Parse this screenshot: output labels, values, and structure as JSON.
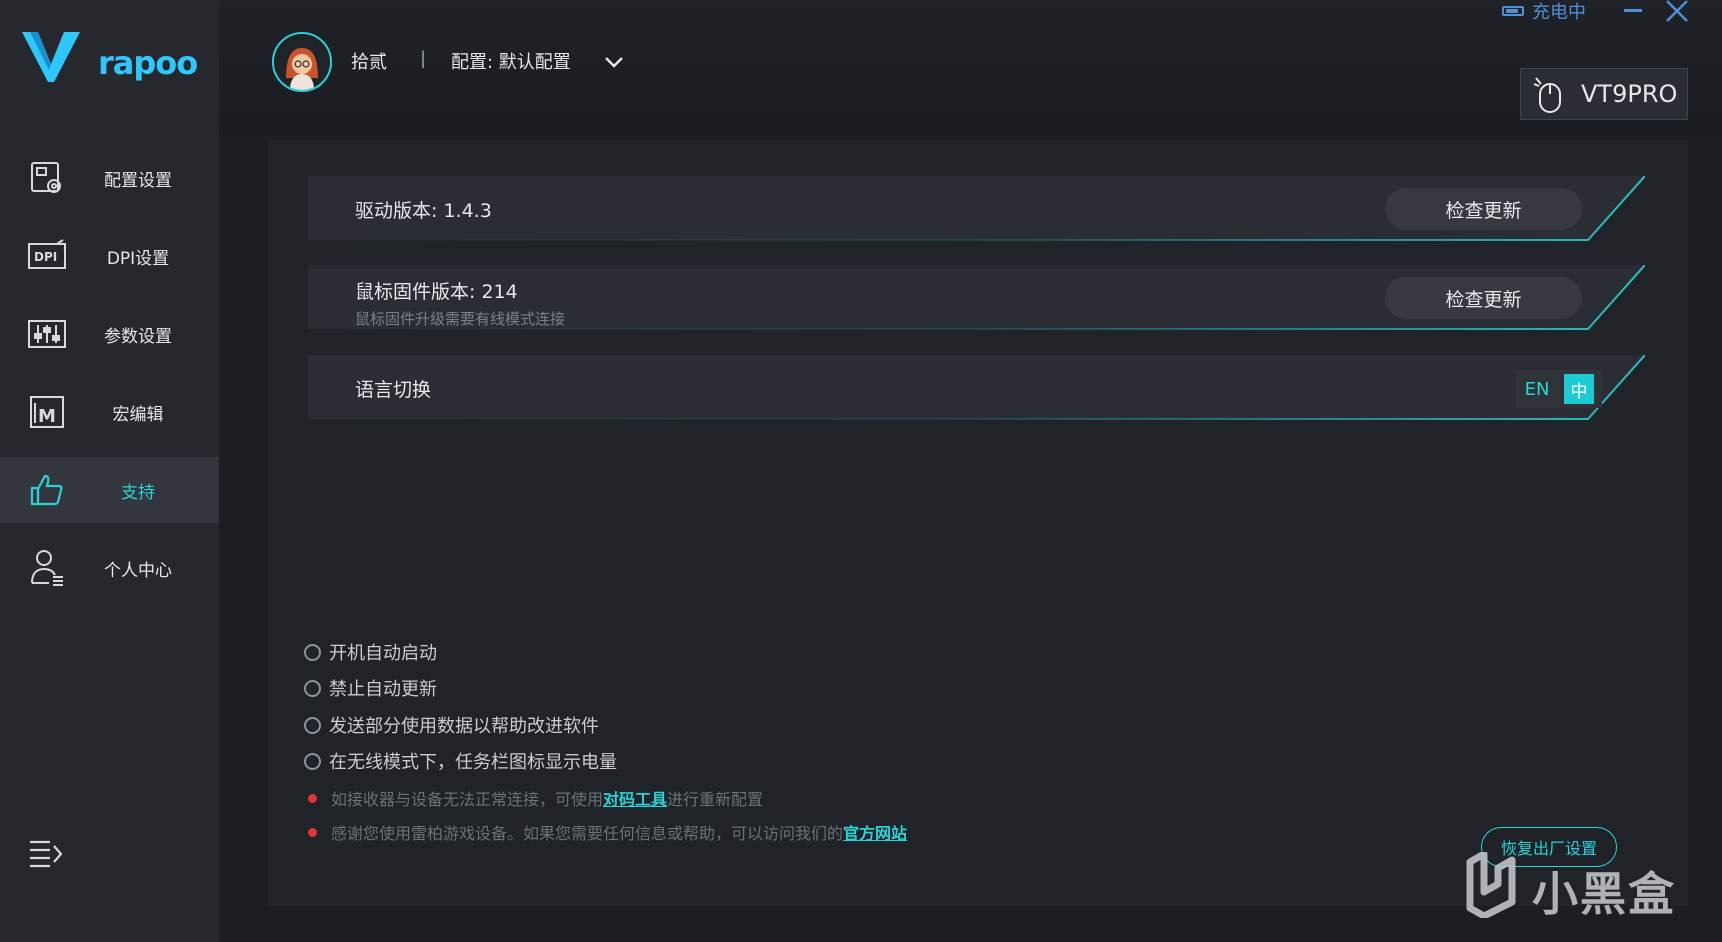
{
  "app": {
    "brand": "rapoo",
    "status": {
      "charging_text": "充电中"
    },
    "device_name": "VT9PRO"
  },
  "sidebar": {
    "items": [
      {
        "label": "配置设置",
        "icon": "profile-config-icon"
      },
      {
        "label": "DPI设置",
        "icon": "dpi-icon"
      },
      {
        "label": "参数设置",
        "icon": "sliders-icon"
      },
      {
        "label": "宏编辑",
        "icon": "macro-icon"
      },
      {
        "label": "支持",
        "icon": "thumbs-up-icon",
        "active": true
      },
      {
        "label": "个人中心",
        "icon": "user-icon"
      }
    ]
  },
  "header": {
    "username": "拾贰",
    "separator": "|",
    "profile_label": "配置: 默认配置"
  },
  "support": {
    "driver": {
      "title": "驱动版本: 1.4.3",
      "button": "检查更新"
    },
    "firmware": {
      "title": "鼠标固件版本:  214",
      "subtitle": "鼠标固件升级需要有线模式连接",
      "button": "检查更新"
    },
    "language": {
      "title": "语言切换",
      "en": "EN",
      "zh": "中",
      "selected": "zh"
    },
    "options": [
      "开机自动启动",
      "禁止自动更新",
      "发送部分使用数据以帮助改进软件",
      "在无线模式下，任务栏图标显示电量"
    ],
    "notes": [
      {
        "before": "如接收器与设备无法正常连接，可使用",
        "link": "对码工具",
        "after": "进行重新配置"
      },
      {
        "before": "感谢您使用雷柏游戏设备。如果您需要任何信息或帮助，可以访问我们的",
        "link": "官方网站",
        "after": ""
      }
    ],
    "reset_button": "恢复出厂设置"
  },
  "watermark": "小黑盒",
  "colors": {
    "accent": "#29d3d8",
    "status_blue": "#4f8fd6",
    "note_dot": "#e3343a"
  }
}
